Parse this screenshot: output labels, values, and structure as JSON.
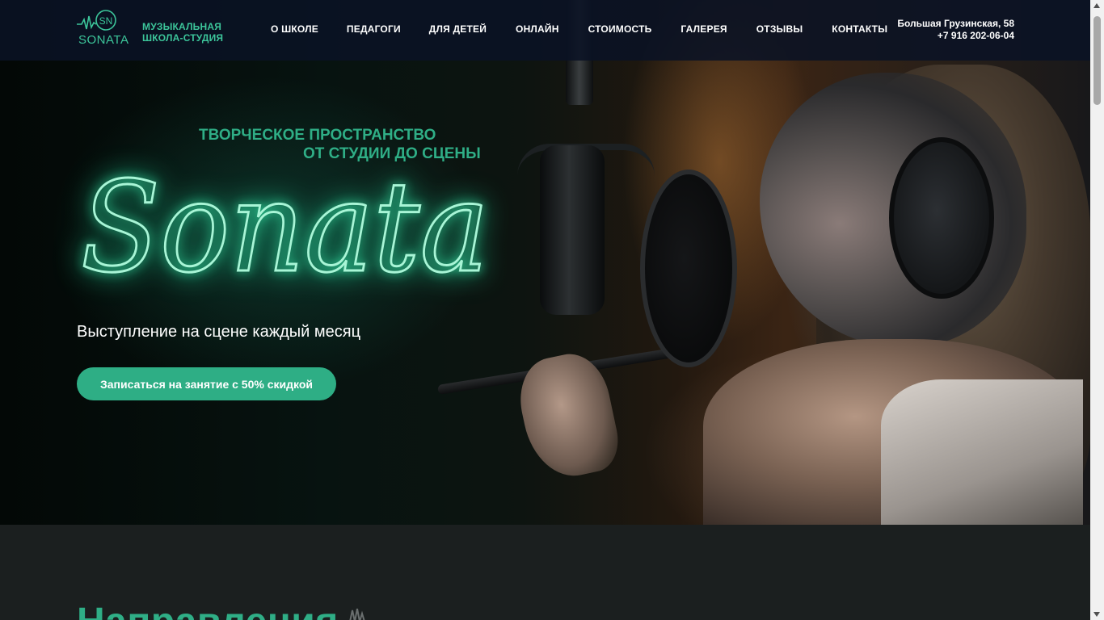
{
  "brand": {
    "logo_monogram": "SN",
    "logo_word": "SONATA",
    "tagline_line1": "МУЗЫКАЛЬНАЯ",
    "tagline_line2": "ШКОЛА-СТУДИЯ",
    "accent_color": "#2eae85",
    "header_bg": "#0a1224"
  },
  "nav": {
    "items": [
      {
        "label": "О ШКОЛЕ"
      },
      {
        "label": "ПЕДАГОГИ"
      },
      {
        "label": "ДЛЯ ДЕТЕЙ"
      },
      {
        "label": "ОНЛАЙН"
      },
      {
        "label": "СТОИМОСТЬ"
      },
      {
        "label": "ГАЛЕРЕЯ"
      },
      {
        "label": "ОТЗЫВЫ"
      },
      {
        "label": "КОНТАКТЫ"
      }
    ]
  },
  "contact": {
    "address": "Большая Грузинская, 58",
    "phone": "+7 916 202-06-04"
  },
  "hero": {
    "subtitle_line1": "ТВОРЧЕСКОЕ ПРОСТРАНСТВО",
    "subtitle_line2": "ОТ СТУДИИ ДО СЦЕНЫ",
    "neon_title": "Sonata",
    "description": "Выступление на сцене каждый месяц",
    "cta_label": "Записаться на занятие с 50% скидкой",
    "neon_color": "#a8f5d6"
  },
  "section": {
    "title": "Направления"
  }
}
